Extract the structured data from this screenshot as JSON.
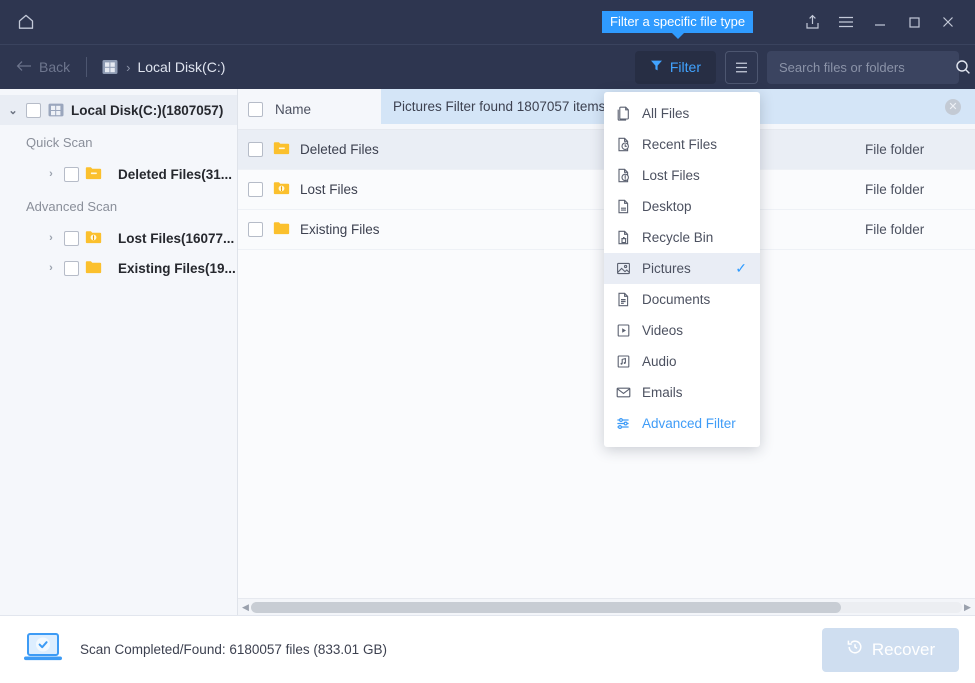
{
  "titlebar": {
    "home_icon": "home-icon",
    "tooltip": "Filter a specific file type",
    "icons": [
      {
        "name": "share-icon",
        "label": "Share"
      },
      {
        "name": "menu-icon",
        "label": "Menu"
      },
      {
        "name": "minimize-icon",
        "label": "Minimize"
      },
      {
        "name": "maximize-icon",
        "label": "Maximize"
      },
      {
        "name": "close-icon",
        "label": "Close"
      }
    ]
  },
  "toolbar": {
    "back_label": "Back",
    "breadcrumb_separator": "›",
    "breadcrumb": "Local Disk(C:)",
    "filter_label": "Filter",
    "list_mode_icon": "list-view-icon",
    "search_placeholder": "Search files or folders",
    "search_value": "",
    "search_icon": "search-icon"
  },
  "sidebar": {
    "root": {
      "label": "Local Disk(C:)(1807057)",
      "expanded": true,
      "caret": "⌄"
    },
    "groups": [
      {
        "label": "Quick Scan",
        "items": [
          {
            "label": "Deleted Files(31...",
            "icon": "deleted-folder-icon",
            "caret": "›"
          }
        ]
      },
      {
        "label": "Advanced Scan",
        "items": [
          {
            "label": "Lost Files(16077...",
            "icon": "lost-folder-icon",
            "caret": "›"
          },
          {
            "label": "Existing Files(19...",
            "icon": "folder-icon",
            "caret": "›"
          }
        ]
      }
    ]
  },
  "main": {
    "columns": {
      "name": "Name"
    },
    "notification": {
      "text": "Pictures Filter found 1807057 items (27.14 GB 0.00)",
      "close_icon": "close-circle-icon"
    },
    "rows": [
      {
        "name": "Deleted Files",
        "type": "File folder",
        "icon": "deleted-folder-icon",
        "selected": true
      },
      {
        "name": "Lost Files",
        "type": "File folder",
        "icon": "lost-folder-icon",
        "selected": false
      },
      {
        "name": "Existing Files",
        "type": "File folder",
        "icon": "folder-icon",
        "selected": false
      }
    ],
    "scrollbar": {
      "left_arrow": "◀",
      "right_arrow": "▶",
      "thumb_percent": 83
    }
  },
  "filter_menu": {
    "items": [
      {
        "label": "All Files",
        "icon": "all-files-icon",
        "checked": false,
        "accent": false
      },
      {
        "label": "Recent Files",
        "icon": "recent-files-icon",
        "checked": false,
        "accent": false
      },
      {
        "label": "Lost Files",
        "icon": "lost-files-icon",
        "checked": false,
        "accent": false
      },
      {
        "label": "Desktop",
        "icon": "desktop-icon",
        "checked": false,
        "accent": false
      },
      {
        "label": "Recycle Bin",
        "icon": "recycle-bin-icon",
        "checked": false,
        "accent": false
      },
      {
        "label": "Pictures",
        "icon": "pictures-icon",
        "checked": true,
        "accent": false
      },
      {
        "label": "Documents",
        "icon": "documents-icon",
        "checked": false,
        "accent": false
      },
      {
        "label": "Videos",
        "icon": "videos-icon",
        "checked": false,
        "accent": false
      },
      {
        "label": "Audio",
        "icon": "audio-icon",
        "checked": false,
        "accent": false
      },
      {
        "label": "Emails",
        "icon": "emails-icon",
        "checked": false,
        "accent": false
      },
      {
        "label": "Advanced Filter",
        "icon": "sliders-icon",
        "checked": false,
        "accent": true
      }
    ],
    "check_glyph": "✓"
  },
  "footer": {
    "status_icon": "scan-complete-icon",
    "status_text": "Scan Completed/Found: 6180057 files (833.01 GB)",
    "recover_label": "Recover",
    "recover_icon": "restore-icon",
    "recover_disabled": true
  },
  "colors": {
    "titlebar_bg": "#2e3650",
    "accent_blue": "#2f9bff",
    "tooltip_bg": "#2f9bff",
    "notification_bg": "#d4e5f7",
    "selected_row": "#eaeef5",
    "folder_yellow": "#fbc02d",
    "recover_disabled_bg": "#cfdef0"
  }
}
